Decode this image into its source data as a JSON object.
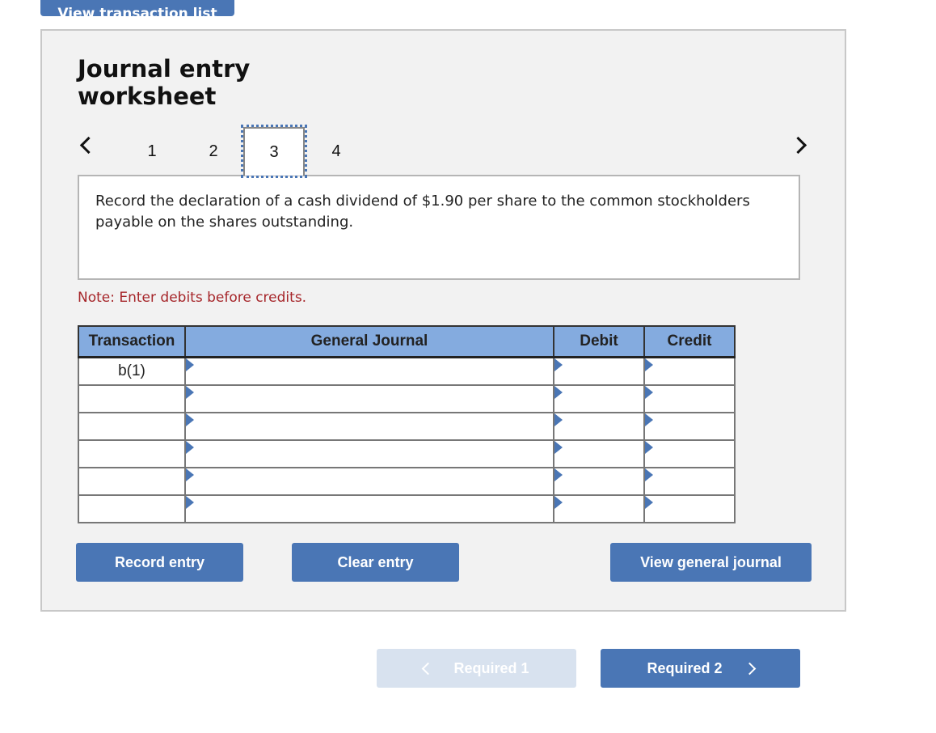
{
  "top_button": {
    "label": "View transaction list"
  },
  "worksheet": {
    "title_line1": "Journal entry",
    "title_line2": "worksheet",
    "pager": {
      "prev_icon": "chevron-left-icon",
      "next_icon": "chevron-right-icon",
      "pages": [
        "1",
        "2",
        "3",
        "4"
      ],
      "active_page": "3"
    },
    "question": "Record the declaration of a cash dividend of $1.90 per share to the common stockholders payable on the shares outstanding.",
    "note": "Note: Enter debits before credits.",
    "table": {
      "headers": [
        "Transaction",
        "General Journal",
        "Debit",
        "Credit"
      ],
      "rows": [
        {
          "transaction": "b(1)",
          "general_journal": "",
          "debit": "",
          "credit": ""
        },
        {
          "transaction": "",
          "general_journal": "",
          "debit": "",
          "credit": ""
        },
        {
          "transaction": "",
          "general_journal": "",
          "debit": "",
          "credit": ""
        },
        {
          "transaction": "",
          "general_journal": "",
          "debit": "",
          "credit": ""
        },
        {
          "transaction": "",
          "general_journal": "",
          "debit": "",
          "credit": ""
        },
        {
          "transaction": "",
          "general_journal": "",
          "debit": "",
          "credit": ""
        }
      ]
    },
    "buttons": {
      "record": "Record entry",
      "clear": "Clear entry",
      "view": "View general journal"
    }
  },
  "navigation": {
    "prev_label": "Required 1",
    "next_label": "Required 2"
  },
  "colors": {
    "accent": "#4a76b5",
    "header_bg": "#84abdf",
    "note_text": "#a6262a",
    "panel_bg": "#f2f2f2",
    "disabled_bg": "#d8e2ef"
  }
}
